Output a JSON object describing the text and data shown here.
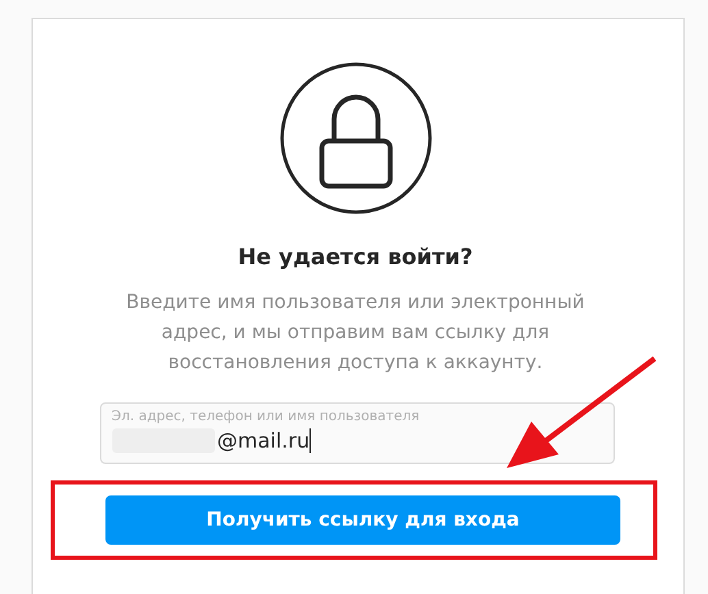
{
  "title": "Не удается войти?",
  "description": "Введите имя пользователя или электронный адрес, и мы отправим вам ссылку для восстановления доступа к аккаунту.",
  "field": {
    "label": "Эл. адрес, телефон или имя пользователя",
    "value": "@mail.ru"
  },
  "button": "Получить ссылку для входа"
}
